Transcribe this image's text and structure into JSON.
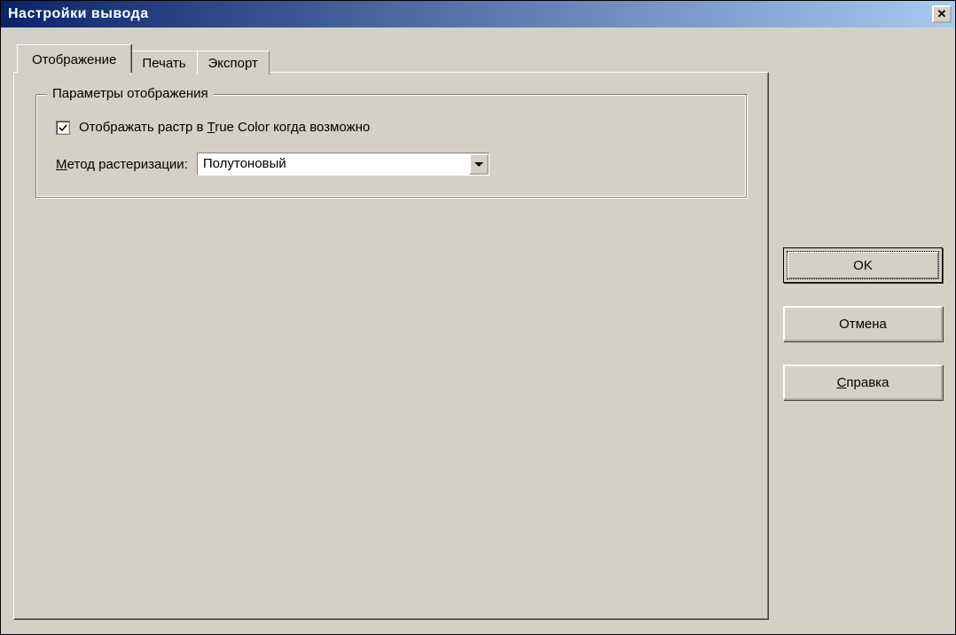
{
  "window": {
    "title": "Настройки вывода"
  },
  "tabs": {
    "display": "Отображение",
    "print": "Печать",
    "export": "Экспорт"
  },
  "group": {
    "title": "Параметры отображения"
  },
  "checkbox": {
    "label_pre": "Отображать растр в ",
    "label_u": "T",
    "label_post": "rue Color когда возможно",
    "checked": true
  },
  "raster": {
    "label_u": "М",
    "label_post": "етод растеризации:",
    "value": "Полутоновый"
  },
  "buttons": {
    "ok": "OK",
    "cancel": "Отмена",
    "help_u": "С",
    "help_post": "правка"
  }
}
